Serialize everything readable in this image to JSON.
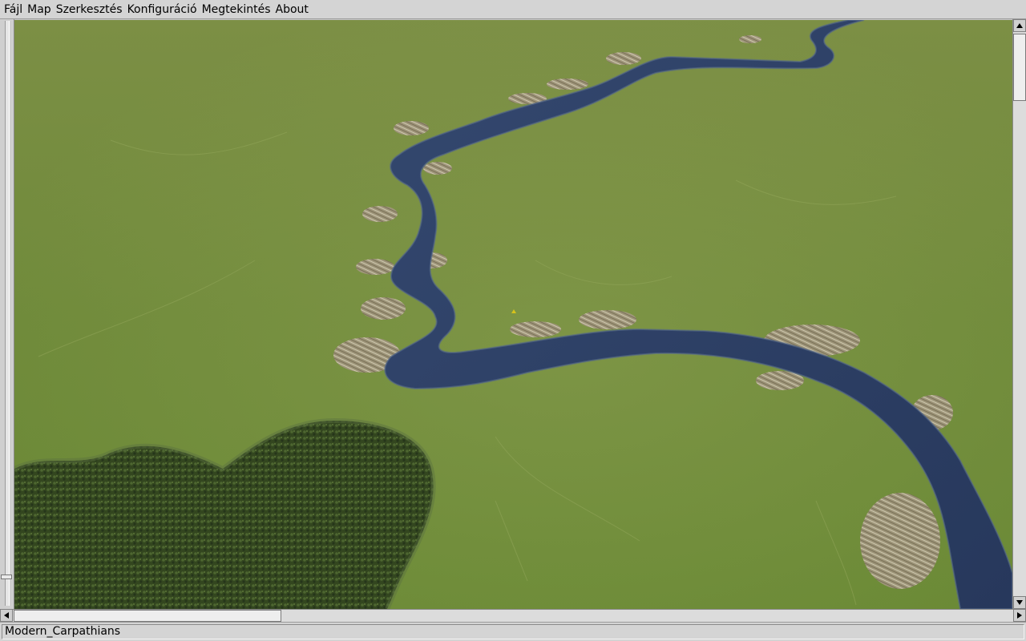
{
  "menu": {
    "items": [
      "Fájl",
      "Map",
      "Szerkesztés",
      "Konfiguráció",
      "Megtekintés",
      "About"
    ]
  },
  "viewport": {
    "scene": "terrain-river-view",
    "colors": {
      "grass": "#6f8a3a",
      "river": "#2c3f66",
      "forest": "#2f4020",
      "bank": "#b8ab93"
    }
  },
  "scrollbars": {
    "vertical_icons": [
      "up-arrow-icon",
      "down-arrow-icon"
    ],
    "horizontal_icons": [
      "left-arrow-icon",
      "right-arrow-icon"
    ]
  },
  "status": {
    "map_name": "Modern_Carpathians"
  }
}
